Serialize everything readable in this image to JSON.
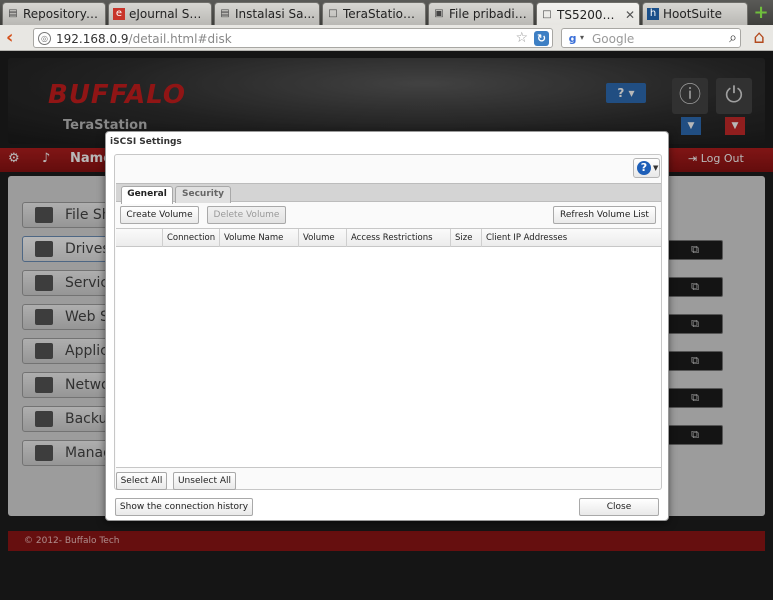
{
  "browser": {
    "tabs": [
      {
        "title": "Repository: ...",
        "icon": "folder-icon"
      },
      {
        "title": "eJournal STK...",
        "icon": "ejournal-icon"
      },
      {
        "title": "Instalasi Sa...",
        "icon": "folder-icon"
      },
      {
        "title": "TeraStation -...",
        "icon": "page-icon"
      },
      {
        "title": "File pribadi s...",
        "icon": "site-icon"
      },
      {
        "title": "TS5200D4...",
        "icon": "page-icon",
        "active": true
      },
      {
        "title": "HootSuite",
        "icon": "hootsuite-icon"
      }
    ],
    "url_host": "192.168.0.9",
    "url_rest": "/detail.html#disk",
    "search_placeholder": "Google"
  },
  "page": {
    "brand": "BUFFALO",
    "product": "TeraStation",
    "help_label": "?",
    "menu": {
      "home_icon": "gear-icon",
      "music_icon": "music-icon",
      "name_label": "Name",
      "logout_label": "Log Out"
    },
    "sidebar": [
      {
        "label": "File Sh",
        "icon": "folder-icon"
      },
      {
        "label": "Drives",
        "icon": "drive-icon",
        "selected": true
      },
      {
        "label": "Servic",
        "icon": "services-icon"
      },
      {
        "label": "Web S",
        "icon": "web-icon"
      },
      {
        "label": "Applic",
        "icon": "apps-icon"
      },
      {
        "label": "Netwo",
        "icon": "network-icon"
      },
      {
        "label": "Backu",
        "icon": "backup-icon"
      },
      {
        "label": "Manag",
        "icon": "tools-icon"
      }
    ],
    "copyright": "© 2012- Buffalo Tech"
  },
  "modal": {
    "title": "iSCSI Settings",
    "tabs": [
      "General",
      "Security"
    ],
    "active_tab": "General",
    "buttons": {
      "create": "Create Volume",
      "delete": "Delete Volume",
      "refresh": "Refresh Volume List",
      "select_all": "Select All",
      "unselect_all": "Unselect All",
      "history": "Show the connection history",
      "close": "Close"
    },
    "columns": [
      "",
      "Connection",
      "Volume Name",
      "Volume",
      "Access Restrictions",
      "Size",
      "Client IP Addresses"
    ],
    "rows": []
  },
  "colors": {
    "brand_red": "#c81e1e",
    "accent_blue": "#2e6db4"
  }
}
